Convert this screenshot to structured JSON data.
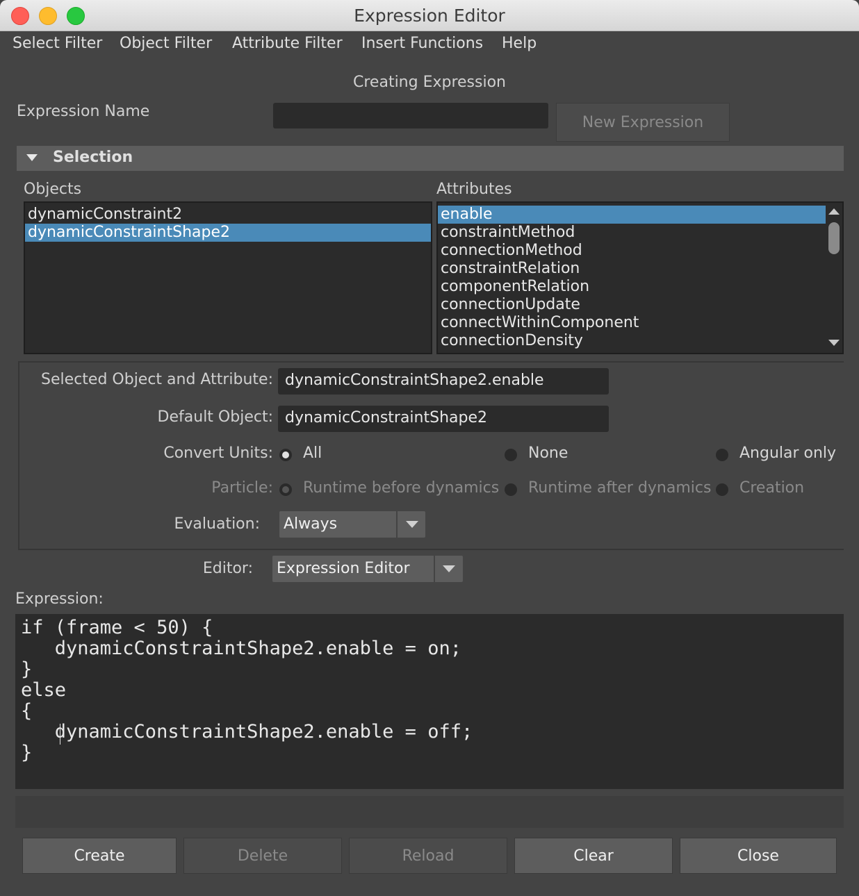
{
  "window": {
    "title": "Expression Editor"
  },
  "menu": [
    "Select Filter",
    "Object Filter",
    "Attribute Filter",
    "Insert Functions",
    "Help"
  ],
  "status_title": "Creating Expression",
  "expression_name": {
    "label": "Expression Name",
    "value": "",
    "new_button": "New Expression"
  },
  "selection": {
    "section_title": "Selection",
    "objects_label": "Objects",
    "attributes_label": "Attributes",
    "objects": [
      "dynamicConstraint2",
      "dynamicConstraintShape2"
    ],
    "attributes": [
      "enable",
      "constraintMethod",
      "connectionMethod",
      "constraintRelation",
      "componentRelation",
      "connectionUpdate",
      "connectWithinComponent",
      "connectionDensity"
    ]
  },
  "details": {
    "selected_label": "Selected Object and Attribute:",
    "selected_value": "dynamicConstraintShape2.enable",
    "default_label": "Default Object:",
    "default_value": "dynamicConstraintShape2",
    "convert_units_label": "Convert Units:",
    "convert_units_options": [
      "All",
      "None",
      "Angular only"
    ],
    "particle_label": "Particle:",
    "particle_options": [
      "Runtime before dynamics",
      "Runtime after dynamics",
      "Creation"
    ],
    "evaluation_label": "Evaluation:",
    "evaluation_value": "Always"
  },
  "editor": {
    "label": "Editor:",
    "value": "Expression Editor"
  },
  "expression": {
    "label": "Expression:",
    "lines": [
      "if (frame < 50) {",
      "   dynamicConstraintShape2.enable = on;",
      "}",
      "else",
      "{",
      "   dynamicConstraintShape2.enable = off;",
      "}"
    ]
  },
  "buttons": [
    "Create",
    "Delete",
    "Reload",
    "Clear",
    "Close"
  ]
}
